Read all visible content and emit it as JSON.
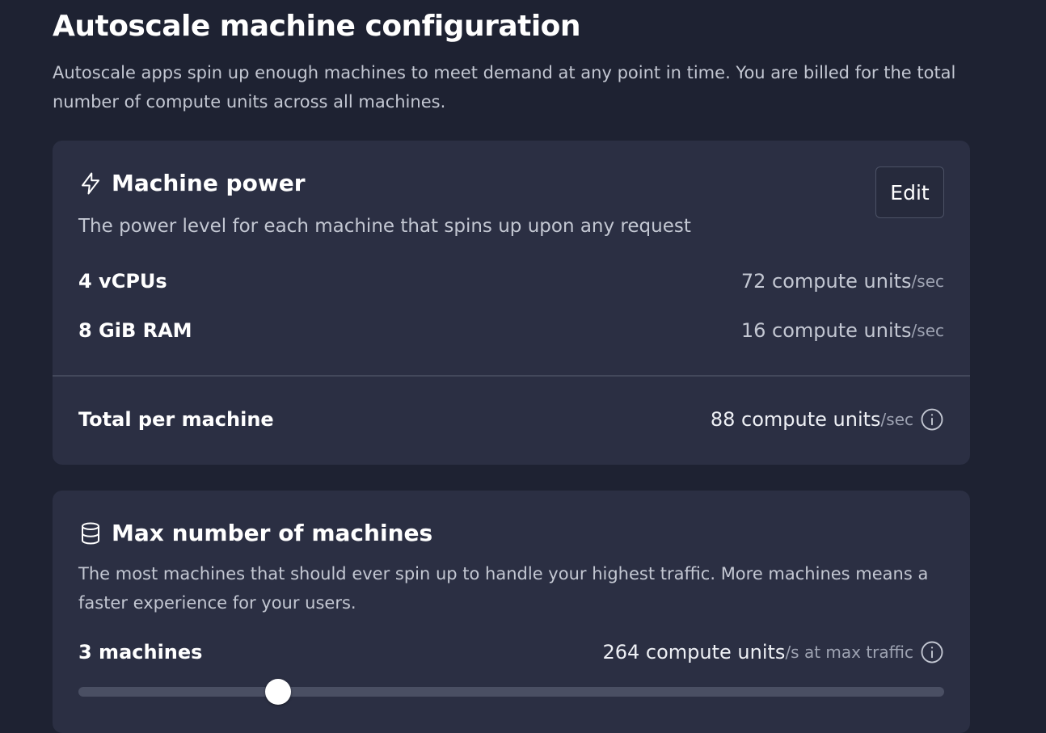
{
  "page": {
    "title": "Autoscale machine configuration",
    "subtitle": "Autoscale apps spin up enough machines to meet demand at any point in time. You are billed for the total number of compute units across all machines."
  },
  "machine_power": {
    "icon": "lightning-icon",
    "title": "Machine power",
    "description": "The power level for each machine that spins up upon any request",
    "edit_label": "Edit",
    "rows": [
      {
        "label": "4 vCPUs",
        "value": "72 compute units",
        "unit": "/sec"
      },
      {
        "label": "8 GiB RAM",
        "value": "16 compute units",
        "unit": "/sec"
      }
    ],
    "total": {
      "label": "Total per machine",
      "value": "88 compute units",
      "unit": "/sec"
    }
  },
  "max_machines": {
    "icon": "database-icon",
    "title": "Max number of machines",
    "description": "The most machines that should ever spin up to handle your highest traffic. More machines means a faster experience for your users.",
    "count_label": "3 machines",
    "value": "264 compute units",
    "unit": "/s at max traffic",
    "slider_value": 0.231
  },
  "colors": {
    "background": "#1e2232",
    "card": "#2b2f43",
    "text_primary": "#ffffff",
    "text_secondary": "#c3c7d2"
  }
}
